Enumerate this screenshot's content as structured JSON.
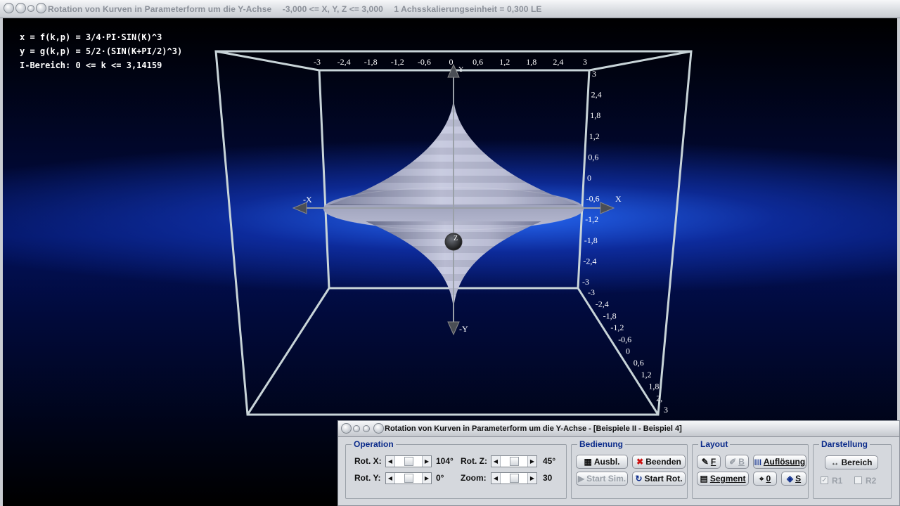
{
  "window": {
    "title_parts": [
      "Rotation von Kurven in Parameterform um die Y-Achse",
      "-3,000 <= X, Y, Z <= 3,000",
      "1 Achsskalierungseinheit = 0,300 LE"
    ]
  },
  "formulas": {
    "x": "x = f(k,p) = 3/4·PI·SIN(K)^3",
    "y": "y = g(k,p) = 5/2·(SIN(K+PI/2)^3)",
    "range": "I-Bereich: 0 <= k <= 3,14159"
  },
  "axes": {
    "top_ticks": [
      "-3",
      "-2,4",
      "-1,8",
      "-1,2",
      "-0,6",
      "0",
      "0,6",
      "1,2",
      "1,8",
      "2,4",
      "3"
    ],
    "right_ticks": [
      "3",
      "2,4",
      "1,8",
      "1,2",
      "0,6",
      "0",
      "-0,6",
      "-1,2",
      "-1,8",
      "-2,4",
      "-3"
    ],
    "depth_ticks": [
      "-3",
      "-2,4",
      "-1,8",
      "-1,2",
      "-0,6",
      "0",
      "0,6",
      "1,2",
      "1,8",
      "2,",
      "3"
    ],
    "labels": {
      "x_pos": "X",
      "x_neg": "-X",
      "y_pos": "Y",
      "y_neg": "-Y",
      "z": "Z"
    }
  },
  "control": {
    "title": "Rotation von Kurven in Parameterform um die Y-Achse - [Beispiele II - Beispiel 4]",
    "operation": {
      "label": "Operation",
      "rot_x_label": "Rot. X:",
      "rot_x_value": "104°",
      "rot_y_label": "Rot. Y:",
      "rot_y_value": "0°",
      "rot_z_label": "Rot. Z:",
      "rot_z_value": "45°",
      "zoom_label": "Zoom:",
      "zoom_value": "30"
    },
    "bedienung": {
      "label": "Bedienung",
      "ausbl": "Ausbl.",
      "beenden": "Beenden",
      "start_sim": "Start Sim.",
      "start_rot": "Start Rot."
    },
    "layout": {
      "label": "Layout",
      "f": "F",
      "b": "B",
      "aufloesung": "Auflösung",
      "segment": "Segment",
      "null": "0",
      "s": "S"
    },
    "darstellung": {
      "label": "Darstellung",
      "bereich": "Bereich",
      "r1": "R1",
      "r2": "R2"
    }
  },
  "colors": {
    "surface": "#a7abc9",
    "frame": "#c8d4d8",
    "accent": "#0a2a8a",
    "close_red": "#cc1111"
  }
}
